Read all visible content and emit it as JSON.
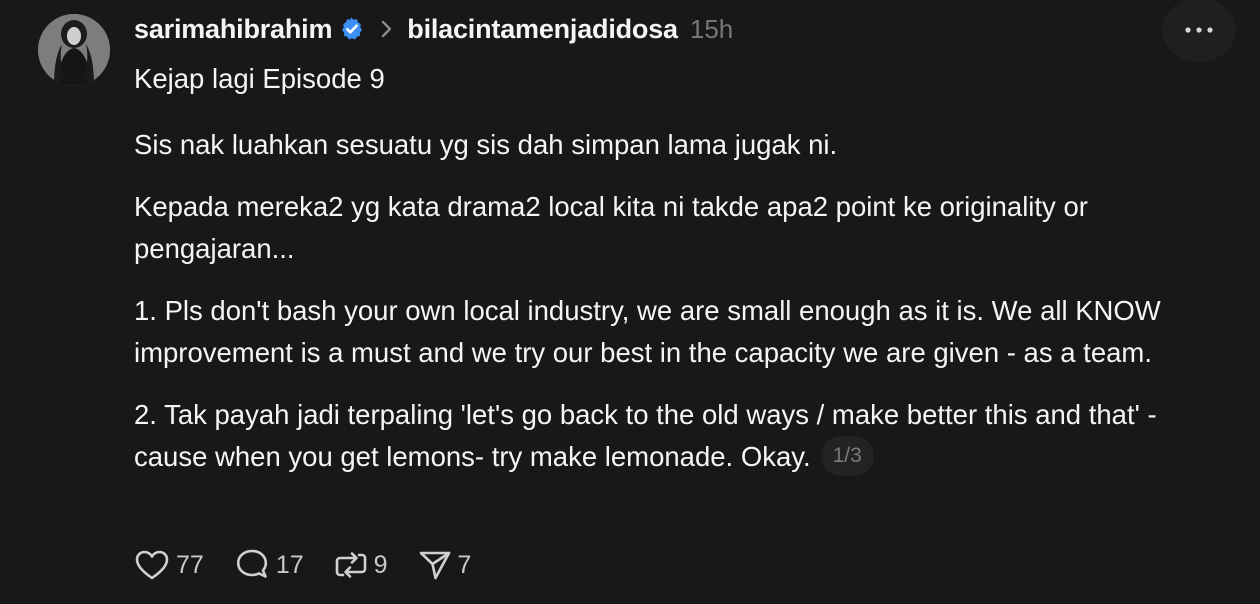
{
  "post": {
    "username": "sarimahibrahim",
    "community": "bilacintamenjadidosa",
    "time": "15h",
    "title_line": "Kejap lagi Episode 9",
    "paragraphs": [
      "Sis nak luahkan sesuatu yg sis dah simpan lama jugak ni.",
      "Kepada mereka2 yg kata drama2 local kita ni takde apa2 point ke originality or pengajaran...",
      "1. Pls don't bash your own local industry, we are small enough as it is. We all KNOW improvement is a must and we try our best in the capacity we are given - as a team.",
      "2. Tak payah jadi terpaling 'let's go back to the old ways / make better this and that' - cause when you get lemons- try make lemonade. Okay."
    ],
    "page_indicator": "1/3"
  },
  "actions": {
    "likes": "77",
    "comments": "17",
    "reposts": "9",
    "shares": "7"
  },
  "colors": {
    "background": "#181818",
    "text": "#f3f5f7",
    "muted": "#777777",
    "verified": "#3d8ff5"
  },
  "icons": {
    "verified": "verified-badge-icon",
    "chevron": "chevron-right-icon",
    "more": "more-horizontal-icon",
    "like": "heart-icon",
    "comment": "comment-icon",
    "repost": "repost-icon",
    "share": "send-icon"
  }
}
